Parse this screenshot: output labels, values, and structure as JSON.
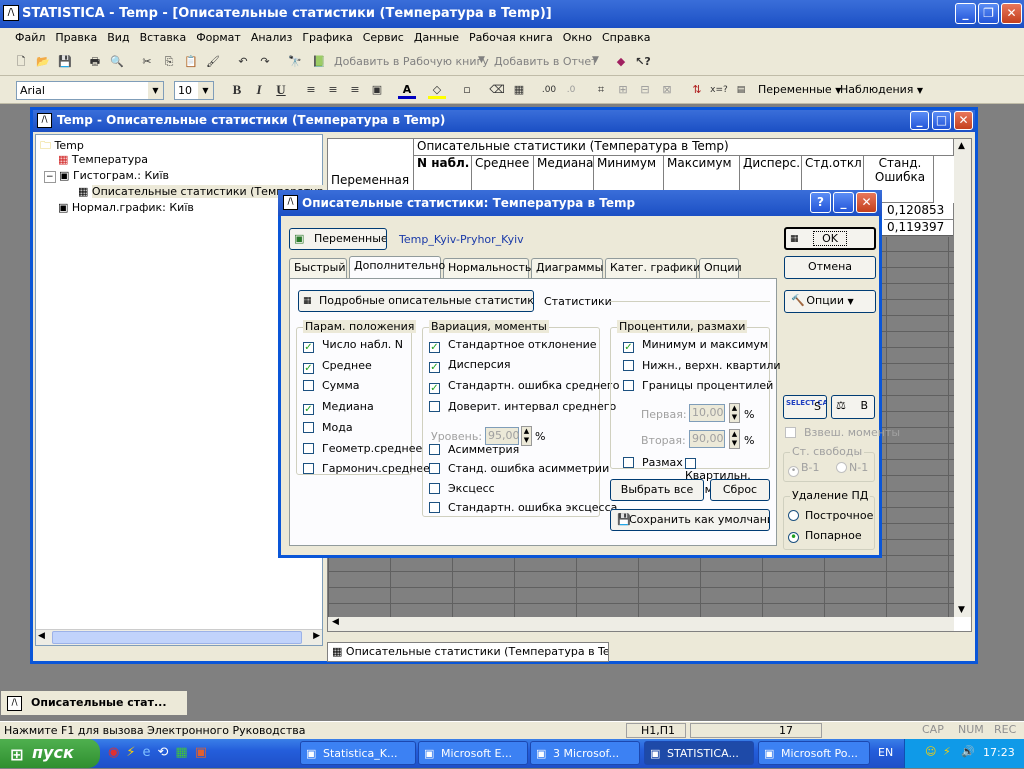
{
  "app": {
    "title": "STATISTICA - Temp - [Описательные статистики (Температура в Temp)]"
  },
  "menu": [
    "Файл",
    "Правка",
    "Вид",
    "Вставка",
    "Формат",
    "Анализ",
    "Графика",
    "Сервис",
    "Данные",
    "Рабочая книга",
    "Окно",
    "Справка"
  ],
  "toolbar1": {
    "add_workbook": "Добавить в Рабочую книгу",
    "add_report": "Добавить в Отчет"
  },
  "toolbar2": {
    "font": "Arial",
    "size": "10",
    "variables": "Переменные",
    "observations": "Наблюдения"
  },
  "workbook": {
    "title": "Temp - Описательные статистики (Температура в Temp)",
    "tree": [
      "Temp",
      "Температура",
      "Гистограм.: Київ",
      "Описательные статистики (Температура в Temp)",
      "Нормал.график: Київ"
    ],
    "sheet_tab": "Описательные статистики (Температура в Temp)"
  },
  "grid": {
    "title": "Описательные статистики (Температура в Temp)",
    "row_header": "Переменная",
    "columns": [
      "N набл.",
      "Среднее",
      "Медиана",
      "Минимум",
      "Максимум",
      "Дисперс.",
      "Стд.откл.",
      "Станд. Ошибка"
    ],
    "values": [
      "0,120853",
      "0,119397"
    ]
  },
  "dialog": {
    "title": "Описательные статистики: Температура в Temp",
    "variables_btn": "Переменные:",
    "variables_val": "Temp_Kyiv-Pryhor_Kyiv",
    "tabs": [
      "Быстрый",
      "Дополнительно",
      "Нормальность",
      "Диаграммы",
      "Катег. графики",
      "Опции"
    ],
    "detail_btn": "Подробные описательные статистики",
    "stats_label": "Статистики",
    "ok": "OK",
    "cancel": "Отмена",
    "options": "Опции",
    "select_cases": "SELECT CASES",
    "s_label": "S",
    "w_label": "W",
    "b_label": "B",
    "weighted": "Взвеш. моменты",
    "df_label": "Ст. свободы",
    "df": [
      "В-1",
      "N-1"
    ],
    "md_label": "Удаление ПД",
    "md": [
      "Построчное",
      "Попарное"
    ],
    "location": {
      "label": "Парам. положения",
      "items": [
        {
          "t": "Число набл. N",
          "c": true
        },
        {
          "t": "Среднее",
          "c": true
        },
        {
          "t": "Сумма",
          "c": false
        },
        {
          "t": "Медиана",
          "c": true
        },
        {
          "t": "Мода",
          "c": false
        },
        {
          "t": "Геометр.среднее",
          "c": false
        },
        {
          "t": "Гармонич.среднее",
          "c": false
        }
      ]
    },
    "variation": {
      "label": "Вариация, моменты",
      "items": [
        {
          "t": "Стандартное отклонение",
          "c": true
        },
        {
          "t": "Дисперсия",
          "c": true
        },
        {
          "t": "Стандартн. ошибка среднего",
          "c": true
        },
        {
          "t": "Доверит. интервал среднего",
          "c": false
        },
        {
          "t": "Асимметрия",
          "c": false
        },
        {
          "t": "Станд. ошибка асимметрии",
          "c": false
        },
        {
          "t": "Эксцесс",
          "c": false
        },
        {
          "t": "Стандартн. ошибка эксцесса",
          "c": false
        }
      ],
      "level_label": "Уровень:",
      "level_val": "95,00",
      "pct": "%"
    },
    "percentiles": {
      "label": "Процентили, размахи",
      "items": [
        {
          "t": "Минимум и максимум",
          "c": true
        },
        {
          "t": "Нижн., верхн. квартили",
          "c": false
        },
        {
          "t": "Границы процентилей",
          "c": false
        }
      ],
      "first_label": "Первая:",
      "first_val": "10,00",
      "second_label": "Вторая:",
      "second_val": "90,00",
      "range": "Размах",
      "qrange": "Квартильн. размах"
    },
    "select_all": "Выбрать все",
    "reset": "Сброс",
    "save_default": "Сохранить как умолчания"
  },
  "status": {
    "hint": "Нажмите F1 для вызова Электронного Руководства",
    "cell": "H1,П1",
    "num": "17",
    "cap": "CAP",
    "numl": "NUM",
    "rec": "REC"
  },
  "minimized": "Описательные стат...",
  "taskbar": {
    "start": "пуск",
    "items": [
      "Statistica_K...",
      "Microsoft E...",
      "3 Microsof...",
      "STATISTICA...",
      "Microsoft Po..."
    ],
    "lang": "EN",
    "clock": "17:23"
  }
}
